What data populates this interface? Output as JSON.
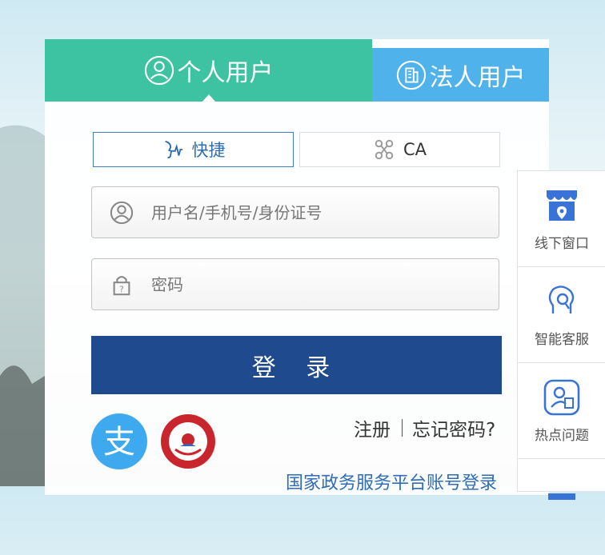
{
  "tabs": {
    "personal": "个人用户",
    "legal": "法人用户"
  },
  "methods": {
    "quick": "快捷",
    "ca": "CA"
  },
  "form": {
    "username_placeholder": "用户名/手机号/身份证号",
    "password_placeholder": "密码",
    "login_label": "登 录"
  },
  "links": {
    "register": "注册",
    "forgot": "忘记密码?",
    "gov_login": "国家政务服务平台账号登录"
  },
  "sidebar": {
    "items": [
      {
        "label": "线下窗口",
        "icon": "storefront-location-icon"
      },
      {
        "label": "智能客服",
        "icon": "robot-assistant-icon"
      },
      {
        "label": "热点问题",
        "icon": "hot-question-icon"
      }
    ]
  },
  "colors": {
    "personal_tab": "#3ec3a2",
    "legal_tab": "#4fb2ea",
    "login_button": "#1f4a8d",
    "link_blue": "#2e6db6"
  }
}
